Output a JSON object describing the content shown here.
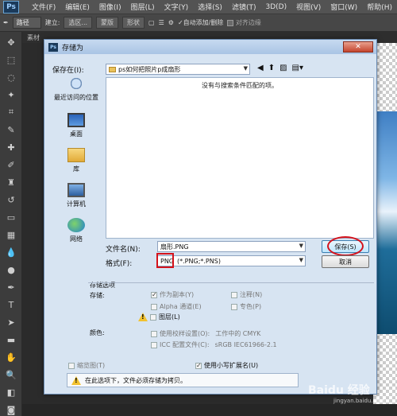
{
  "ps": {
    "logo": "Ps",
    "menus": [
      "文件(F)",
      "编辑(E)",
      "图像(I)",
      "图层(L)",
      "文字(Y)",
      "选择(S)",
      "滤镜(T)",
      "3D(D)",
      "视图(V)",
      "窗口(W)",
      "帮助(H)"
    ],
    "options": {
      "mode": "路径",
      "build_label": "建立:",
      "selection": "选区...",
      "mask": "蒙版",
      "shape": "形状",
      "autoadd": "✓自动添加/删除",
      "align_edges": "对齐边缘",
      "align_checked": true
    },
    "tab_label": "素材"
  },
  "dialog": {
    "title": "存储为",
    "close": "✕",
    "save_in_label": "保存在(I):",
    "save_in_value": "ps如何把照片p成扇形",
    "empty_msg": "没有与搜索条件匹配的项。",
    "places": [
      "最近访问的位置",
      "桌面",
      "库",
      "计算机",
      "网络"
    ],
    "filename_label": "文件名(N):",
    "filename_value": "扇形.PNG",
    "format_label": "格式(F):",
    "format_value": "PNG",
    "format_exts": "(*.PNG;*.PNS)",
    "save_btn": "保存(S)",
    "cancel_btn": "取消",
    "options_title": "存储选项",
    "store_label": "存储:",
    "opt_copy": "作为副本(Y)",
    "opt_notes": "注释(N)",
    "opt_alpha": "Alpha 通道(E)",
    "opt_spot": "专色(P)",
    "opt_layers": "图层(L)",
    "color_label": "颜色:",
    "opt_proof": "使用校样设置(O):",
    "opt_proof_val": "工作中的 CMYK",
    "opt_icc": "ICC 配置文件(C):",
    "opt_icc_val": "sRGB IEC61966-2.1",
    "opt_thumb": "缩览图(T)",
    "opt_lower": "使用小写扩展名(U)",
    "warning": "在此选项下，文件必须存储为拷贝。"
  },
  "watermark": "Baidu 经验",
  "watermark_sub": "jingyan.baidu.com",
  "colors": {
    "ps_bg": "#535353",
    "dialog_bg": "#d7e4f2",
    "highlight": "#d4121b"
  }
}
